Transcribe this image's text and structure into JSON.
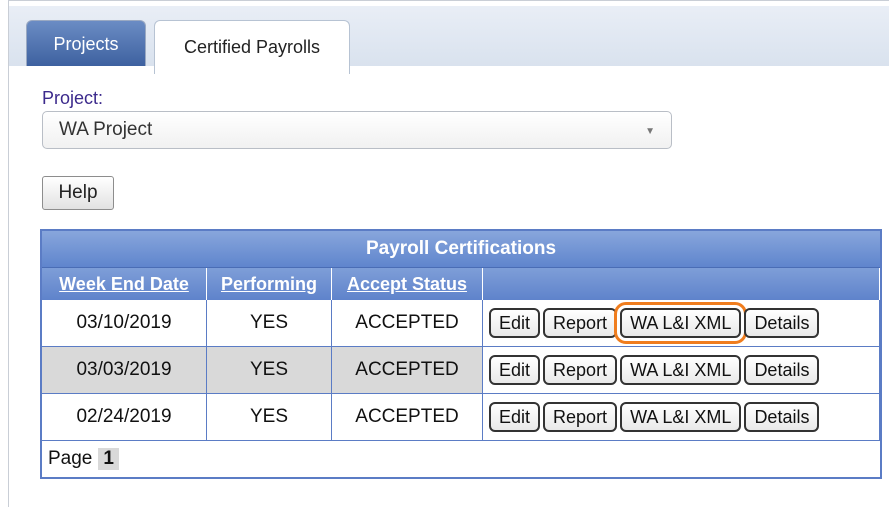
{
  "tabs": [
    {
      "label": "Projects"
    },
    {
      "label": "Certified Payrolls"
    }
  ],
  "project": {
    "label": "Project:",
    "selected": "WA Project"
  },
  "help_label": "Help",
  "grid": {
    "title": "Payroll Certifications",
    "columns": [
      "Week End Date",
      "Performing",
      "Accept Status"
    ],
    "rows": [
      {
        "week_end": "03/10/2019",
        "performing": "YES",
        "status": "ACCEPTED"
      },
      {
        "week_end": "03/03/2019",
        "performing": "YES",
        "status": "ACCEPTED"
      },
      {
        "week_end": "02/24/2019",
        "performing": "YES",
        "status": "ACCEPTED"
      }
    ],
    "actions": {
      "edit": "Edit",
      "report": "Report",
      "wa_xml": "WA L&I XML",
      "details": "Details"
    },
    "pager": {
      "label": "Page",
      "current": "1"
    }
  },
  "colors": {
    "tab_active_bg": "#3b5f9e",
    "grid_header": "#5f85cd",
    "highlight": "#f07d1e"
  }
}
